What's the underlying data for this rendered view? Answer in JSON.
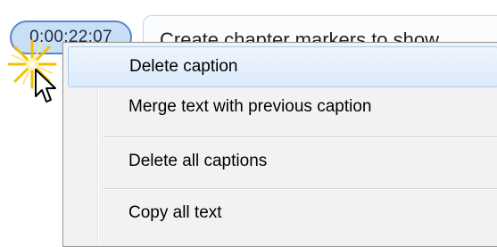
{
  "timestamp": {
    "label": "0:00:22:07"
  },
  "caption": {
    "text": "Create chapter markers to show"
  },
  "context_menu": {
    "items": [
      {
        "label": "Delete caption",
        "hovered": true
      },
      {
        "label": "Merge text with previous caption",
        "hovered": false
      },
      {
        "label": "Delete all captions",
        "hovered": false
      },
      {
        "label": "Copy all text",
        "hovered": false
      }
    ]
  },
  "icons": {
    "click_indicator": "click-burst-icon",
    "pointer": "mouse-pointer-icon"
  },
  "colors": {
    "pill_fill": "#c9dff5",
    "pill_border": "#5b86c5",
    "menu_hover": "#dbeafb",
    "burst": "#f2c200"
  }
}
